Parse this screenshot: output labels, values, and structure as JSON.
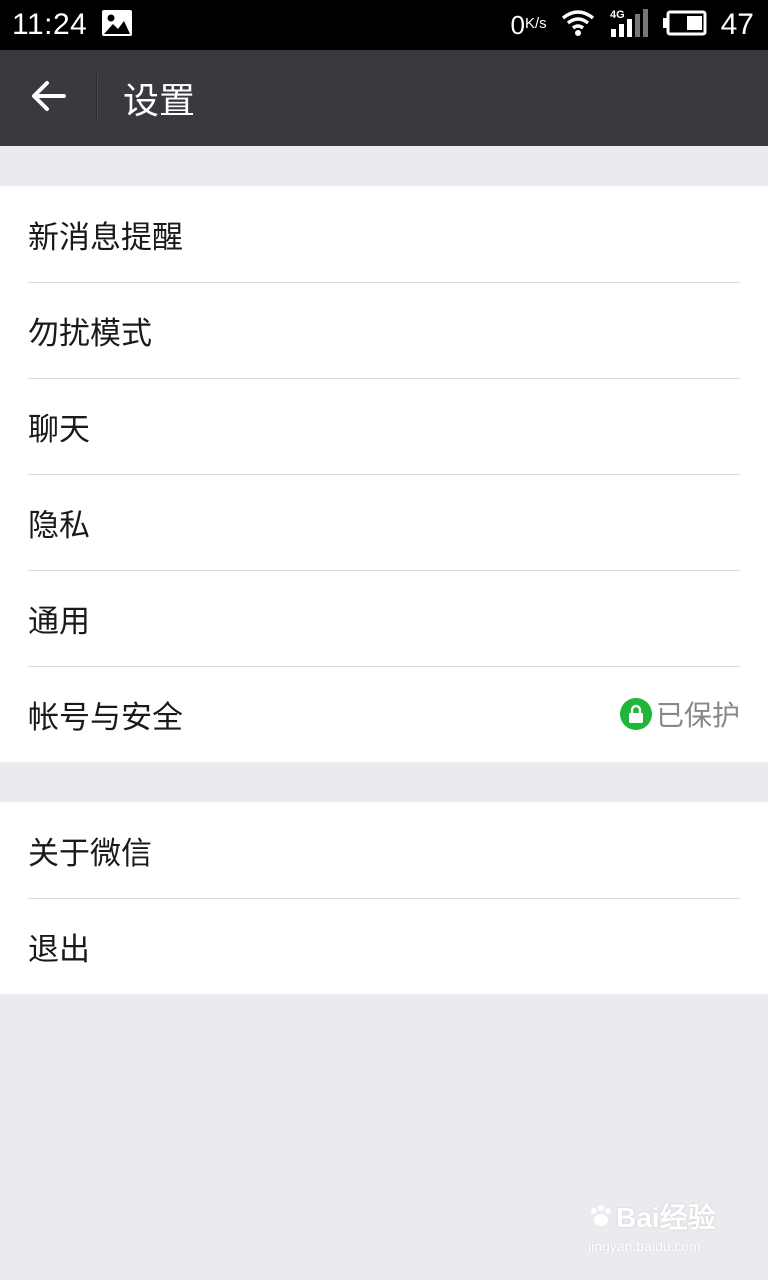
{
  "status_bar": {
    "time": "11:24",
    "net_speed": "0",
    "net_unit": "K/s",
    "network_type": "4G",
    "battery_level": "47",
    "icons": [
      "image-icon",
      "wifi-icon",
      "signal-icon",
      "battery-icon"
    ]
  },
  "app_bar": {
    "title": "设置",
    "back_icon": "arrow-left-icon"
  },
  "groups": [
    {
      "items": [
        {
          "label": "新消息提醒"
        },
        {
          "label": "勿扰模式"
        },
        {
          "label": "聊天"
        },
        {
          "label": "隐私"
        },
        {
          "label": "通用"
        },
        {
          "label": "帐号与安全",
          "status": "已保护",
          "status_icon": "lock-icon",
          "status_color": "#20b63a"
        }
      ]
    },
    {
      "items": [
        {
          "label": "关于微信"
        },
        {
          "label": "退出"
        }
      ]
    }
  ],
  "watermark": {
    "brand": "Bai经验",
    "url": "jingyan.baidu.com"
  },
  "colors": {
    "app_bar": "#393a3f",
    "background": "#ebeaee",
    "accent_green": "#20b63a"
  }
}
